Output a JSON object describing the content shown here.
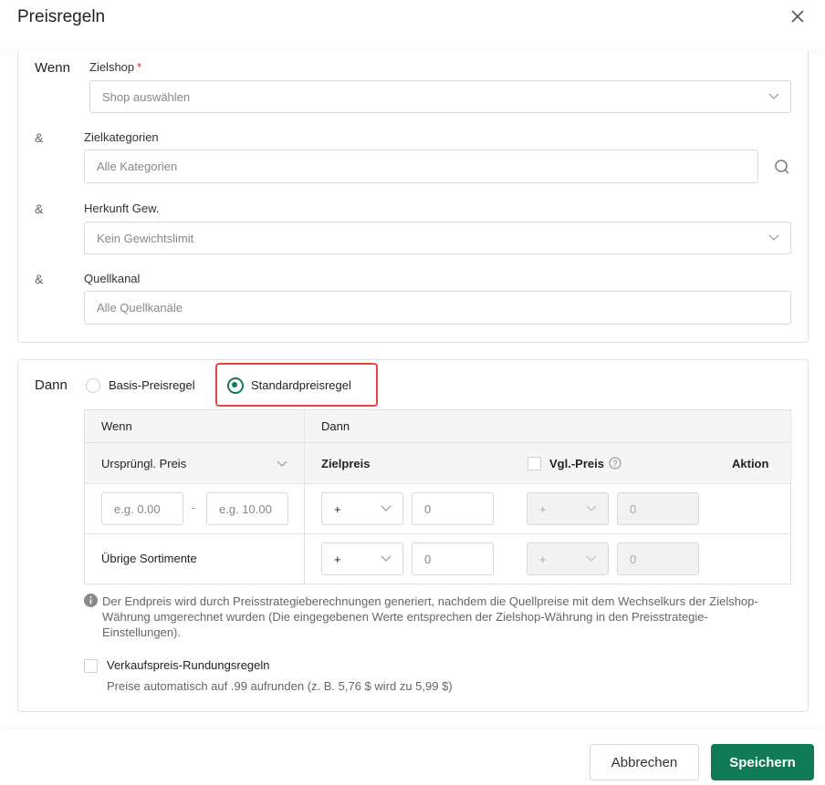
{
  "dialog": {
    "title": "Preisregeln"
  },
  "if_section": {
    "label": "Wenn",
    "amp": "&",
    "target_shop": {
      "label": "Zielshop",
      "required_mark": "*",
      "placeholder": "Shop auswählen"
    },
    "target_categories": {
      "label": "Zielkategorien",
      "placeholder": "Alle Kategorien"
    },
    "weight_origin": {
      "label": "Herkunft Gew.",
      "value": "Kein Gewichtslimit"
    },
    "source_channel": {
      "label": "Quellkanal",
      "placeholder": "Alle Quellkanäle"
    }
  },
  "then_section": {
    "label": "Dann",
    "radio_basic": "Basis-Preisregel",
    "radio_standard": "Standardpreisregel",
    "selected": "Standardpreisregel",
    "table": {
      "head_if": "Wenn",
      "head_then": "Dann",
      "original_price_select": "Ursprüngl. Preis",
      "target_price": "Zielpreis",
      "compare_price": "Vgl.-Preis",
      "action": "Aktion",
      "rows": [
        {
          "from_placeholder": "e.g. 0.00",
          "separator": "-",
          "to_placeholder": "e.g. 10.00",
          "op": "+",
          "value": "0",
          "cmp_op": "+",
          "cmp_value": "0"
        },
        {
          "label": "Übrige Sortimente",
          "op": "+",
          "value": "0",
          "cmp_op": "+",
          "cmp_value": "0"
        }
      ]
    },
    "info": "Der Endpreis wird durch Preisstrategieberechnungen generiert, nachdem die Quellpreise mit dem Wechselkurs der Zielshop-Währung umgerechnet wurden (Die eingegebenen Werte entsprechen der Zielshop-Währung in den Preisstrategie-Einstellungen).",
    "rounding": {
      "label": "Verkaufspreis-Rundungsregeln",
      "hint": "Preise automatisch auf .99 aufrunden (z. B. 5,76 $ wird zu 5,99 $)",
      "checked": false
    }
  },
  "footer": {
    "cancel": "Abbrechen",
    "save": "Speichern"
  },
  "colors": {
    "accent": "#0f7a55",
    "highlight": "#e5483a",
    "required": "#e02424"
  },
  "icons": {
    "close": "close-icon",
    "search": "search-icon",
    "chevron": "chevron-down-icon",
    "help": "help-icon",
    "info": "info-icon"
  }
}
